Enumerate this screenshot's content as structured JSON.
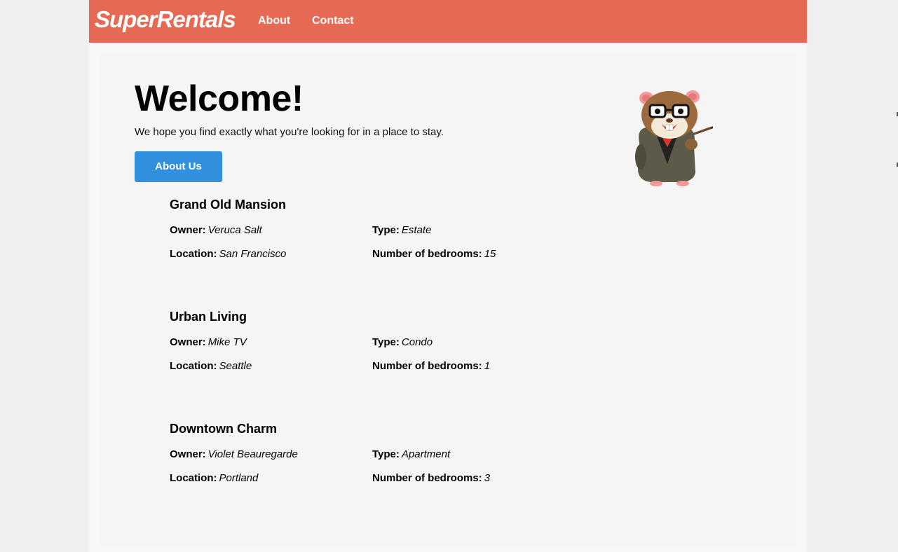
{
  "menu": {
    "brand": "SuperRentals",
    "links": [
      "About",
      "Contact"
    ]
  },
  "jumbo": {
    "title": "Welcome!",
    "tagline": "We hope you find exactly what you're looking for in a place to stay.",
    "button_label": "About Us",
    "mascot_icon": "tomster-hamster-mascot-with-pointer"
  },
  "rentals": [
    {
      "title": "Grand Old Mansion",
      "owner_label": "Owner:",
      "owner": "Veruca Salt",
      "type_label": "Type:",
      "type": "Estate",
      "location_label": "Location:",
      "location": "San Francisco",
      "bedrooms_label": "Number of bedrooms:",
      "bedrooms": "15"
    },
    {
      "title": "Urban Living",
      "owner_label": "Owner:",
      "owner": "Mike TV",
      "type_label": "Type:",
      "type": "Condo",
      "location_label": "Location:",
      "location": "Seattle",
      "bedrooms_label": "Number of bedrooms:",
      "bedrooms": "1"
    },
    {
      "title": "Downtown Charm",
      "owner_label": "Owner:",
      "owner": "Violet Beauregarde",
      "type_label": "Type:",
      "type": "Apartment",
      "location_label": "Location:",
      "location": "Portland",
      "bedrooms_label": "Number of bedrooms:",
      "bedrooms": "3"
    }
  ],
  "colors": {
    "menu_bg": "#e66954",
    "button_bg": "#3090dd",
    "panel_bg": "#f5f5f5"
  }
}
